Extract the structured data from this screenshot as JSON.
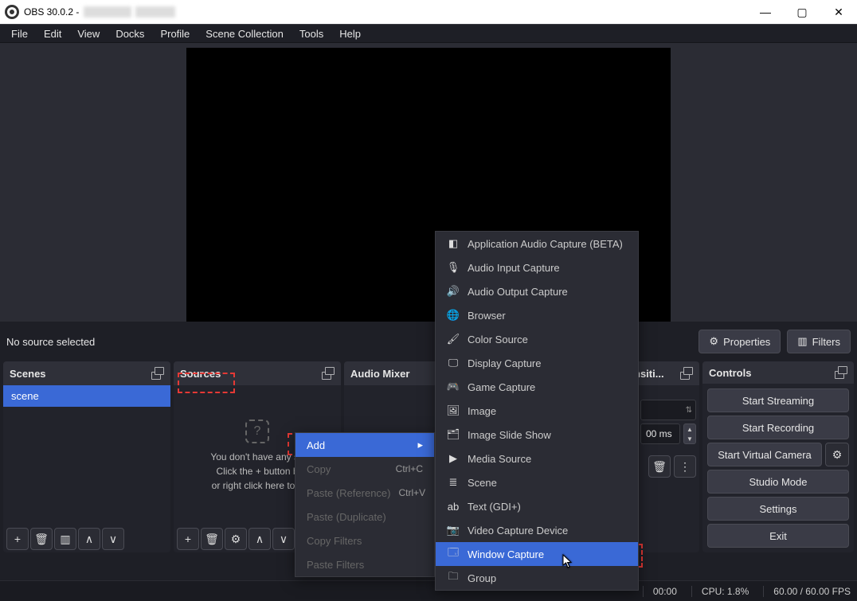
{
  "title": "OBS 30.0.2 -",
  "menubar": [
    "File",
    "Edit",
    "View",
    "Docks",
    "Profile",
    "Scene Collection",
    "Tools",
    "Help"
  ],
  "toolbar": {
    "target": "No source selected",
    "properties": "Properties",
    "filters": "Filters"
  },
  "docks": {
    "scenes": {
      "title": "Scenes",
      "items": [
        "scene"
      ]
    },
    "sources": {
      "title": "Sources",
      "empty1": "You don't have any so",
      "empty2": "Click the + button b",
      "empty3": "or right click here to a"
    },
    "mixer": {
      "title": "Audio Mixer"
    },
    "transitions": {
      "title": "nsiti...",
      "duration": "00 ms"
    },
    "controls": {
      "title": "Controls",
      "buttons": [
        "Start Streaming",
        "Start Recording",
        "Start Virtual Camera",
        "Studio Mode",
        "Settings",
        "Exit"
      ]
    }
  },
  "context_menu_primary": [
    {
      "label": "Add",
      "enabled": true,
      "submenu": true,
      "hl": true
    },
    {
      "label": "Copy",
      "shortcut": "Ctrl+C",
      "enabled": false
    },
    {
      "label": "Paste (Reference)",
      "shortcut": "Ctrl+V",
      "enabled": false
    },
    {
      "label": "Paste (Duplicate)",
      "enabled": false
    },
    {
      "label": "Copy Filters",
      "enabled": false
    },
    {
      "label": "Paste Filters",
      "enabled": false
    }
  ],
  "context_menu_sources": [
    {
      "icon": "app-audio",
      "label": "Application Audio Capture (BETA)"
    },
    {
      "icon": "mic",
      "label": "Audio Input Capture"
    },
    {
      "icon": "speaker",
      "label": "Audio Output Capture"
    },
    {
      "icon": "globe",
      "label": "Browser"
    },
    {
      "icon": "brush",
      "label": "Color Source"
    },
    {
      "icon": "display",
      "label": "Display Capture"
    },
    {
      "icon": "gamepad",
      "label": "Game Capture"
    },
    {
      "icon": "image",
      "label": "Image"
    },
    {
      "icon": "slides",
      "label": "Image Slide Show"
    },
    {
      "icon": "play",
      "label": "Media Source"
    },
    {
      "icon": "list",
      "label": "Scene"
    },
    {
      "icon": "text",
      "label": "Text (GDI+)"
    },
    {
      "icon": "camera",
      "label": "Video Capture Device"
    },
    {
      "icon": "window",
      "label": "Window Capture",
      "hl": true
    },
    {
      "icon": "folder",
      "label": "Group"
    }
  ],
  "statusbar": {
    "time": "00:00",
    "cpu": "CPU: 1.8%",
    "fps": "60.00 / 60.00 FPS"
  }
}
